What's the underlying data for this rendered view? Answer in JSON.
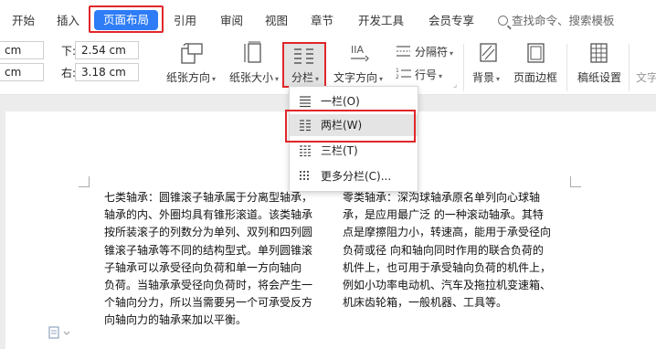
{
  "menubar": {
    "items": [
      "开始",
      "插入",
      "页面布局",
      "引用",
      "审阅",
      "视图",
      "章节",
      "开发工具",
      "会员专享"
    ],
    "active": "页面布局",
    "search_placeholder": "查找命令、搜索模板"
  },
  "ribbon": {
    "margin_left_value": "cm",
    "margin_right_value": "cm",
    "bottom_label": "下:",
    "bottom_value": "2.54 cm",
    "right_label": "右:",
    "right_value": "3.18 cm",
    "orientation_label": "纸张方向",
    "size_label": "纸张大小",
    "columns_label": "分栏",
    "text_direction_label": "文字方向",
    "separator_label": "分隔符",
    "line_number_label": "行号",
    "background_label": "背景",
    "page_border_label": "页面边框",
    "paper_setting_label": "稿纸设置",
    "text_cut_label": "文字"
  },
  "dropdown": {
    "items": [
      {
        "label": "一栏(O)"
      },
      {
        "label": "两栏(W)"
      },
      {
        "label": "三栏(T)"
      },
      {
        "label": "更多分栏(C)..."
      }
    ],
    "selected_index": 1
  },
  "document": {
    "left_column": [
      "七类轴承：圆锥滚子轴承属于分离型轴承，",
      "轴承的内、外圈均具有锥形滚道。该类轴承",
      "按所装滚子的列数分为单列、双列和四列圆",
      "锥滚子轴承等不同的结构型式。单列圆锥滚",
      "子轴承可以承受径向负荷和单一方向轴向",
      "负荷。当轴承承受径向负荷时，将会产生一",
      "个轴向分力，所以当需要另一个可承受反方",
      "向轴向力的轴承来加以平衡。"
    ],
    "right_column": [
      "零类轴承：深沟球轴承原名单列向心球轴",
      "承，是应用最广泛  的一种滚动轴承。其特",
      "点是摩擦阻力小，转速高，能用于承受径向",
      "负荷或径  向和轴向同时作用的联合负荷的",
      "机件上，也可用于承受轴向负荷的机件上，",
      "例如小功率电动机、汽车及拖拉机变速箱、",
      "机床齿轮箱，一般机器、工具等。"
    ]
  },
  "colors": {
    "accent": "#2e7cf6",
    "highlight": "#e0262b"
  }
}
